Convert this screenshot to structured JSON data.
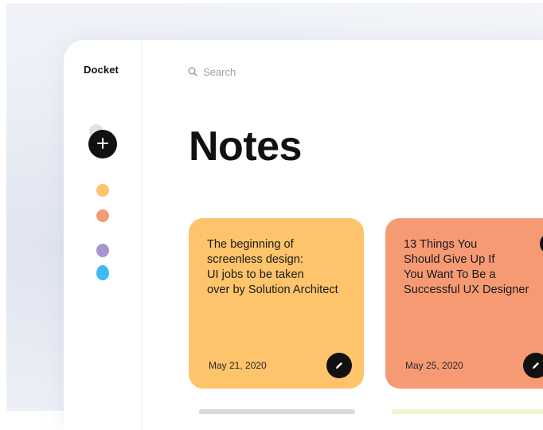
{
  "sidebar": {
    "brand": "Docket",
    "add_icon": "plus-icon",
    "colors": {
      "yellow": "#fdc46b",
      "orange": "#f69a74",
      "purple": "#a795cc",
      "blue": "#3dbaf4"
    }
  },
  "search": {
    "placeholder": "Search",
    "icon": "search-icon"
  },
  "page": {
    "title": "Notes"
  },
  "notes": [
    {
      "text": "The beginning of\nscreenless design:\nUI jobs to be taken\nover by Solution Architect",
      "date": "May 21, 2020",
      "color": "#fdc46b",
      "starred": false
    },
    {
      "text": "13 Things You\nShould Give Up If\nYou Want To Be a\nSuccessful UX Designer",
      "date": "May 25, 2020",
      "color": "#f69a74",
      "starred": true
    }
  ]
}
